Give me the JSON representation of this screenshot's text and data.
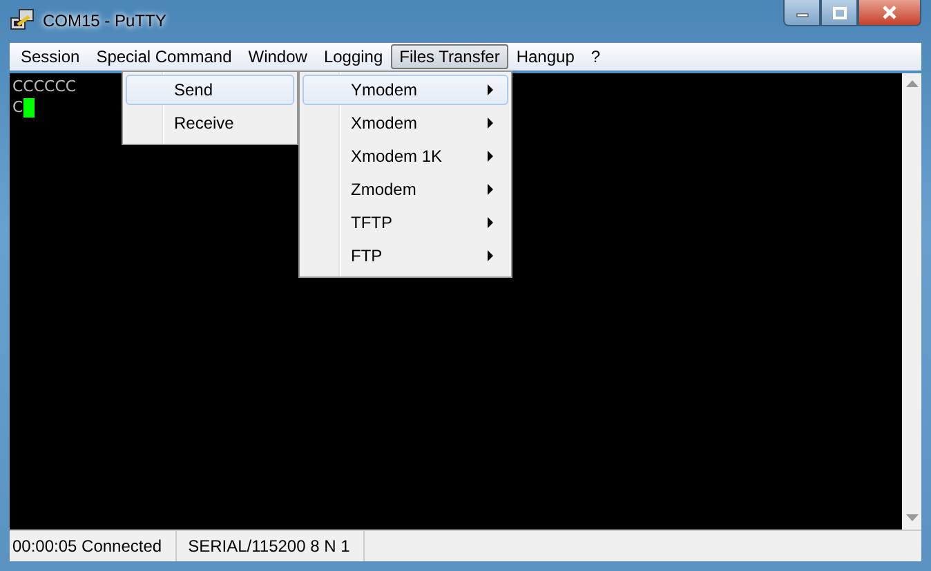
{
  "window": {
    "title": "COM15 - PuTTY"
  },
  "menu_bar": [
    {
      "label": "Session",
      "selected": false
    },
    {
      "label": "Special Command",
      "selected": false
    },
    {
      "label": "Window",
      "selected": false
    },
    {
      "label": "Logging",
      "selected": false
    },
    {
      "label": "Files Transfer",
      "selected": true
    },
    {
      "label": "Hangup",
      "selected": false
    },
    {
      "label": "?",
      "selected": false
    }
  ],
  "submenu": [
    {
      "label": "Ymodem",
      "selected": true
    },
    {
      "label": "Xmodem",
      "selected": false
    },
    {
      "label": "Xmodem 1K",
      "selected": false
    },
    {
      "label": "Zmodem",
      "selected": false
    },
    {
      "label": "TFTP",
      "selected": false
    },
    {
      "label": "FTP",
      "selected": false
    }
  ],
  "action_menu": [
    {
      "label": "Send",
      "selected": true
    },
    {
      "label": "Receive",
      "selected": false
    }
  ],
  "terminal": {
    "lines": [
      "CCCCCC",
      "C"
    ]
  },
  "status_bar": [
    "00:00:05 Connected",
    "SERIAL/115200 8 N 1"
  ]
}
